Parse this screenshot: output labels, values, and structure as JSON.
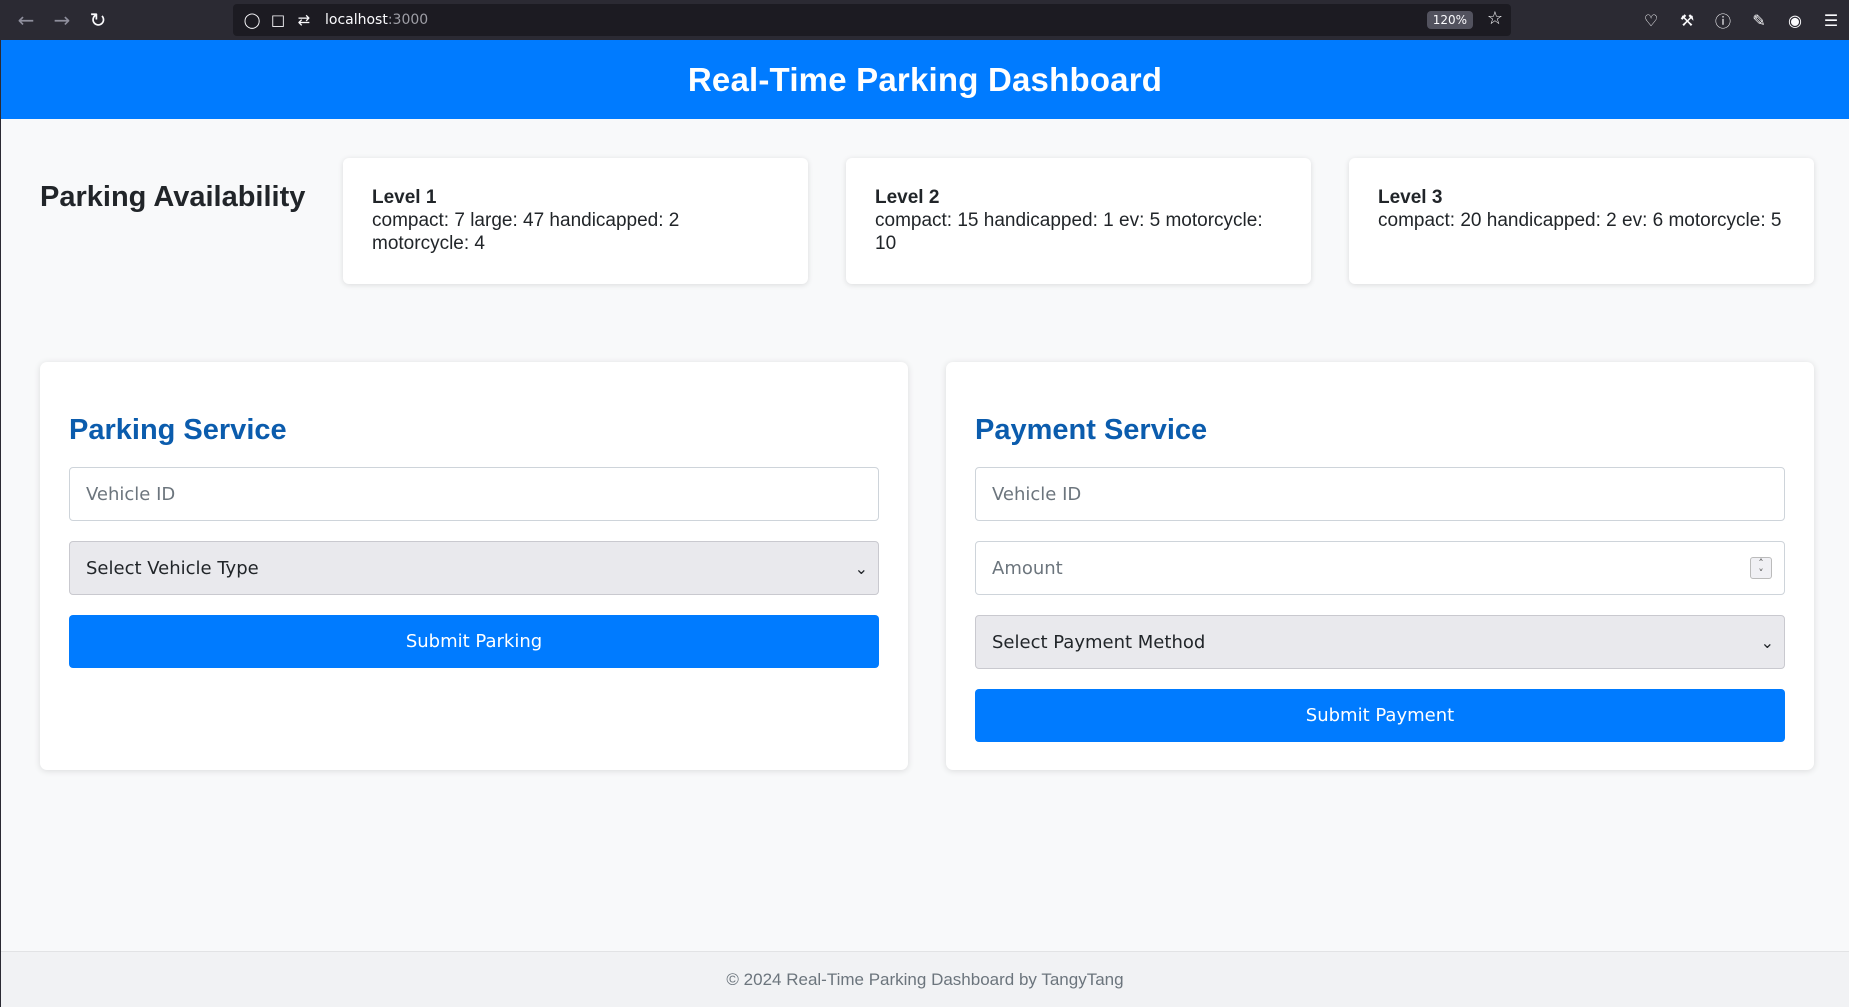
{
  "browser": {
    "url_host": "localhost",
    "url_port": ":3000",
    "zoom": "120%"
  },
  "header": {
    "title": "Real-Time Parking Dashboard"
  },
  "availability": {
    "title": "Parking Availability",
    "levels": [
      {
        "name": "Level 1",
        "info": "compact: 7 large: 47 handicapped: 2 motorcycle: 4"
      },
      {
        "name": "Level 2",
        "info": "compact: 15 handicapped: 1 ev: 5 motorcycle: 10"
      },
      {
        "name": "Level 3",
        "info": "compact: 20 handicapped: 2 ev: 6 motorcycle: 5"
      }
    ]
  },
  "parking_service": {
    "title": "Parking Service",
    "vehicle_id_placeholder": "Vehicle ID",
    "vehicle_type_selected": "Select Vehicle Type",
    "submit_label": "Submit Parking"
  },
  "payment_service": {
    "title": "Payment Service",
    "vehicle_id_placeholder": "Vehicle ID",
    "amount_placeholder": "Amount",
    "payment_method_selected": "Select Payment Method",
    "submit_label": "Submit Payment"
  },
  "footer": {
    "text": "© 2024 Real-Time Parking Dashboard by TangyTang"
  },
  "colors": {
    "primary": "#007bff",
    "heading": "#0b5cad",
    "background": "#f8f9fa"
  }
}
